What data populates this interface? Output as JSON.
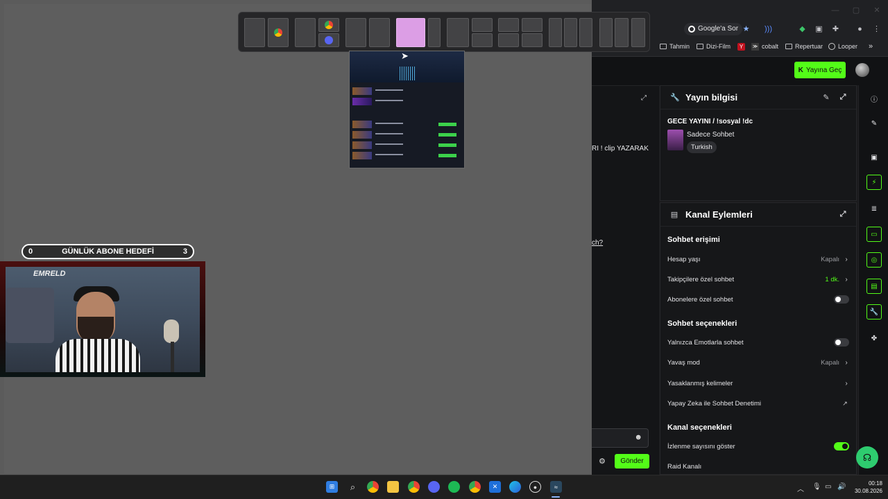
{
  "browser": {
    "search_pill": "Google'a Sor",
    "bookmarks": [
      "Tahmin",
      "Dizi-Film",
      "cobalt",
      "Repertuar",
      "Looper"
    ],
    "more_bookmarks": "»"
  },
  "snap_layout": {
    "highlight_color": "#dc9ee5"
  },
  "overlay": {
    "goal_label": "GÜNLÜK ABONE HEDEFİ",
    "goal_current": "0",
    "goal_target": "3",
    "neon_sign": "EMRELD"
  },
  "header": {
    "go_live_label": "Yayına Geç"
  },
  "chat": {
    "snippet_1": "RI ! clip YAZARAK",
    "snippet_2": "ch?",
    "send_label": "Gönder"
  },
  "stream_info": {
    "title": "Yayın bilgisi",
    "stream_title": "GECE YAYINI / !sosyal !dc",
    "category": "Sadece Sohbet",
    "language_tag": "Turkish"
  },
  "channel_actions": {
    "title": "Kanal Eylemleri",
    "chat_access": {
      "heading": "Sohbet erişimi",
      "account_age": {
        "label": "Hesap yaşı",
        "value": "Kapalı"
      },
      "followers_only": {
        "label": "Takipçilere özel sohbet",
        "value": "1 dk."
      },
      "subscribers_only": {
        "label": "Abonelere özel sohbet"
      }
    },
    "chat_options": {
      "heading": "Sohbet seçenekleri",
      "emote_only": {
        "label": "Yalnızca Emotlarla sohbet"
      },
      "slow_mode": {
        "label": "Yavaş mod",
        "value": "Kapalı"
      },
      "banned_words": {
        "label": "Yasaklanmış kelimeler"
      },
      "ai_moderation": {
        "label": "Yapay Zeka ile Sohbet Denetimi"
      }
    },
    "channel_options": {
      "heading": "Kanal seçenekleri",
      "show_viewcount": {
        "label": "İzlenme sayısını göster"
      },
      "raid_channel": {
        "label": "Raid Kanalı"
      }
    }
  },
  "toggles": {
    "subscribers_only": false,
    "emote_only": false,
    "show_viewcount": true
  },
  "colors": {
    "accent_green": "#53fc18",
    "snap_highlight": "#dc9ee5"
  },
  "clock": {
    "time": "00:18",
    "date": "30.08.2026"
  }
}
